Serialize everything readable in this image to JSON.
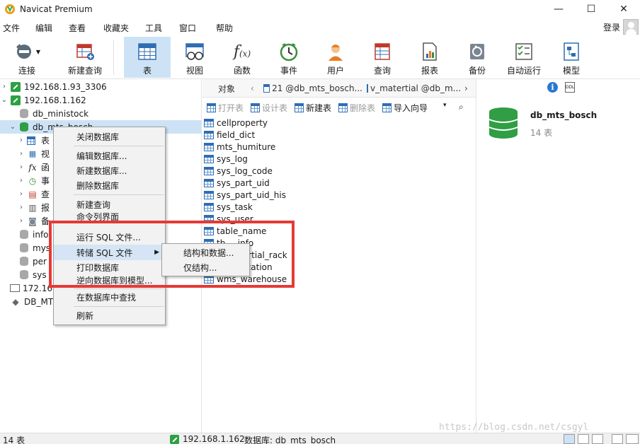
{
  "window": {
    "title": "Navicat Premium",
    "minimize": "—",
    "maximize": "☐",
    "close": "✕"
  },
  "menu": {
    "items": [
      "文件",
      "编辑",
      "查看",
      "收藏夹",
      "工具",
      "窗口",
      "帮助"
    ],
    "login": "登录"
  },
  "toolbar": {
    "items": [
      {
        "label": "连接",
        "icon": "plug-icon"
      },
      {
        "label": "新建查询",
        "icon": "new-query-icon"
      },
      {
        "label": "表",
        "icon": "table-icon",
        "active": true
      },
      {
        "label": "视图",
        "icon": "view-icon"
      },
      {
        "label": "函数",
        "icon": "function-icon"
      },
      {
        "label": "事件",
        "icon": "clock-icon"
      },
      {
        "label": "用户",
        "icon": "user-icon"
      },
      {
        "label": "查询",
        "icon": "query-icon"
      },
      {
        "label": "报表",
        "icon": "report-icon"
      },
      {
        "label": "备份",
        "icon": "backup-icon"
      },
      {
        "label": "自动运行",
        "icon": "automation-icon"
      },
      {
        "label": "模型",
        "icon": "model-icon"
      }
    ]
  },
  "tree": {
    "rows": [
      {
        "label": "192.168.1.93_3306"
      },
      {
        "label": "192.168.1.162"
      },
      {
        "label": "db_ministock"
      },
      {
        "label": "db_mts_bosch"
      },
      {
        "label": "表"
      },
      {
        "label": "视"
      },
      {
        "label": "函"
      },
      {
        "label": "事"
      },
      {
        "label": "查"
      },
      {
        "label": "报"
      },
      {
        "label": "备"
      },
      {
        "label": "info"
      },
      {
        "label": "mys"
      },
      {
        "label": "per"
      },
      {
        "label": "sys"
      },
      {
        "label": "172.16"
      },
      {
        "label": "DB_MT"
      }
    ]
  },
  "tabs": {
    "object": "对象",
    "tab1": "21 @db_mts_bosch...",
    "tab2": "v_matertial @db_m..."
  },
  "subtoolbar": {
    "open": "打开表",
    "design": "设计表",
    "new": "新建表",
    "delete": "删除表",
    "import": "导入向导"
  },
  "tables": [
    "cellproperty",
    "field_dict",
    "mts_humiture",
    "sys_log",
    "sys_log_code",
    "sys_part_uid",
    "sys_part_uid_his",
    "sys_task",
    "sys_user",
    "table_name",
    "tb_...info",
    "v_matertial_rack",
    "...ck_location",
    "wms_warehouse"
  ],
  "info": {
    "name": "db_mts_bosch",
    "count": "14 表"
  },
  "context_menu": {
    "items": [
      "关闭数据库",
      "编辑数据库...",
      "新建数据库...",
      "删除数据库",
      "新建查询",
      "命令列界面",
      "运行 SQL 文件...",
      "转储 SQL 文件",
      "打印数据库",
      "逆向数据库到模型...",
      "在数据库中查找",
      "刷新"
    ]
  },
  "submenu": {
    "items": [
      "结构和数据...",
      "仅结构..."
    ]
  },
  "status": {
    "count": "14 表",
    "connection": "192.168.1.162",
    "database": "数据库: db_mts_bosch"
  },
  "watermark": "https://blog.csdn.net/csgyl"
}
